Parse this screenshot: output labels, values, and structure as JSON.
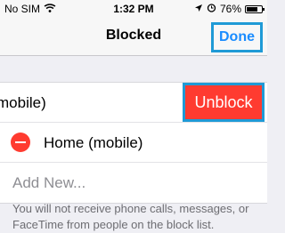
{
  "status_bar": {
    "carrier": "No SIM",
    "time": "1:32 PM",
    "battery_percent": "76%",
    "battery_level": 0.76
  },
  "nav": {
    "title": "Blocked",
    "done_label": "Done"
  },
  "blocked_list": {
    "swiped_row_label": "mobile)",
    "unblock_label": "Unblock",
    "rows": [
      {
        "label": "Home (mobile)"
      }
    ],
    "add_new_label": "Add New..."
  },
  "footer": {
    "text": "You will not receive phone calls, messages, or FaceTime from people on the block list."
  },
  "colors": {
    "accent": "#1a8cff",
    "destructive": "#ff3b30",
    "highlight_border": "#1f9ad6"
  }
}
